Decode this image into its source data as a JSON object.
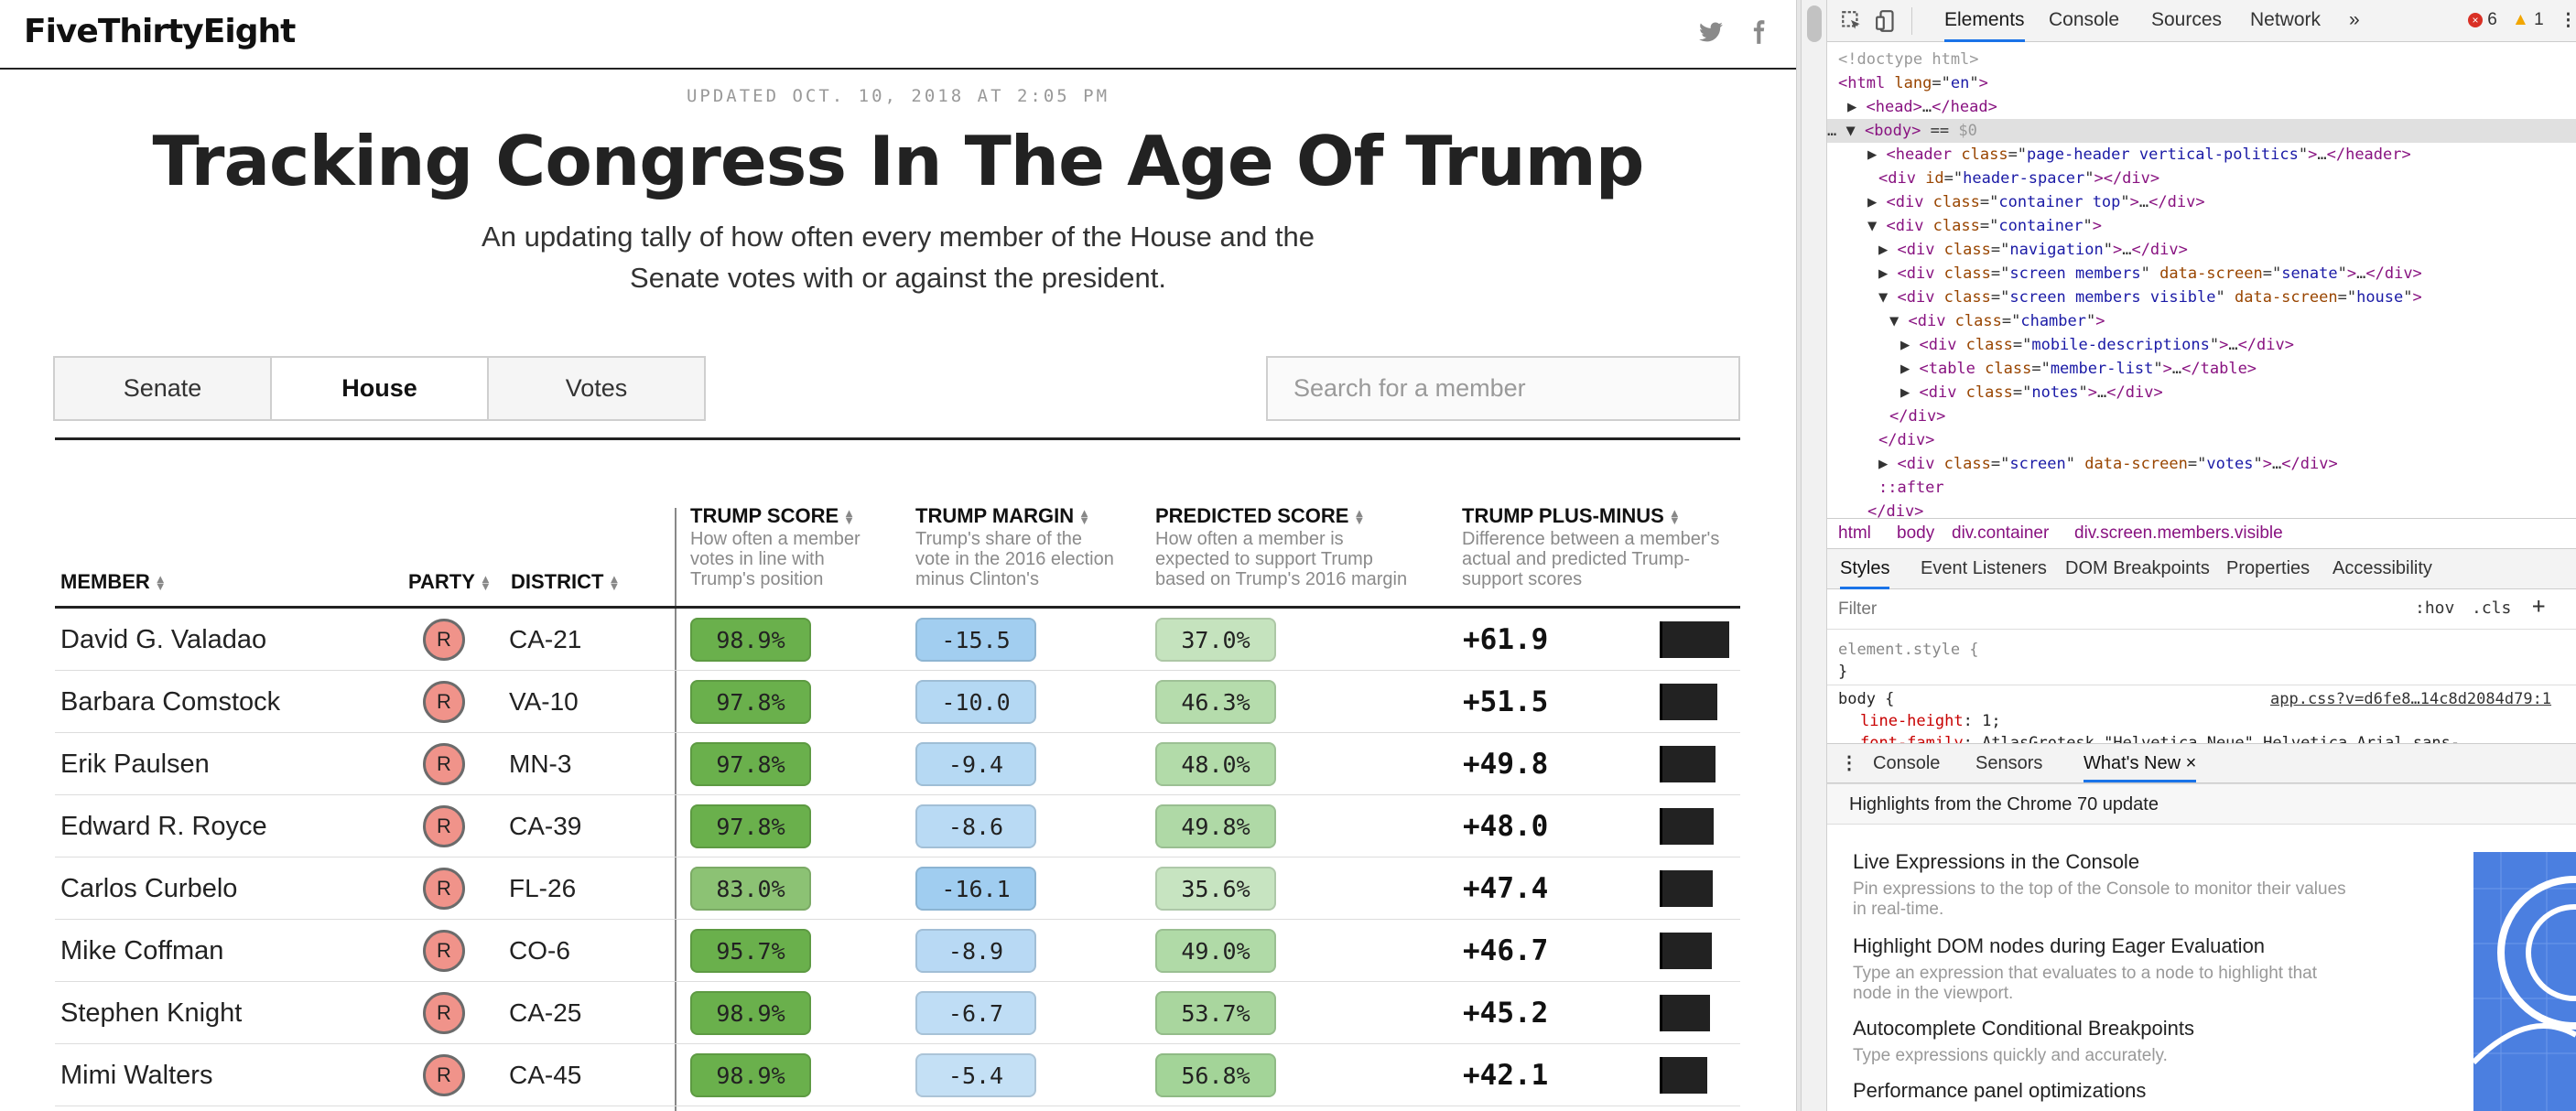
{
  "site": {
    "logo": "FiveThirtyEight",
    "twitter_icon": "twitter-icon",
    "facebook_icon": "facebook-icon"
  },
  "article": {
    "updated": "UPDATED OCT. 10, 2018 AT 2:05 PM",
    "title": "Tracking Congress In The Age Of Trump",
    "subtitle_line1": "An updating tally of how often every member of the House and the",
    "subtitle_line2": "Senate votes with or against the president."
  },
  "tabs": [
    {
      "label": "Senate",
      "active": false
    },
    {
      "label": "House",
      "active": true
    },
    {
      "label": "Votes",
      "active": false
    }
  ],
  "search": {
    "placeholder": "Search for a member"
  },
  "table": {
    "columns": {
      "member": "MEMBER",
      "party": "PARTY",
      "district": "DISTRICT",
      "trump_score": "TRUMP SCORE",
      "trump_score_desc": [
        "How often a member",
        "votes in line with",
        "Trump's position"
      ],
      "trump_margin": "TRUMP MARGIN",
      "trump_margin_desc": [
        "Trump's share of the",
        "vote in the 2016 election",
        "minus Clinton's"
      ],
      "predicted_score": "PREDICTED SCORE",
      "predicted_score_desc": [
        "How often a member is",
        "expected to support Trump",
        "based on Trump's 2016 margin"
      ],
      "plus_minus": "TRUMP PLUS-MINUS",
      "plus_minus_desc": [
        "Difference between a member's",
        "actual and predicted Trump-",
        "support scores"
      ]
    },
    "sort_icon": "sort-arrows-icon",
    "party_color": "#f0938a",
    "rows": [
      {
        "member": "David G. Valadao",
        "party": "R",
        "district": "CA-21",
        "trump_score": "98.9%",
        "trump_margin": "-15.5",
        "predicted_score": "37.0%",
        "plus_minus": "+61.9",
        "plus_minus_value": 61.9
      },
      {
        "member": "Barbara Comstock",
        "party": "R",
        "district": "VA-10",
        "trump_score": "97.8%",
        "trump_margin": "-10.0",
        "predicted_score": "46.3%",
        "plus_minus": "+51.5",
        "plus_minus_value": 51.5
      },
      {
        "member": "Erik Paulsen",
        "party": "R",
        "district": "MN-3",
        "trump_score": "97.8%",
        "trump_margin": "-9.4",
        "predicted_score": "48.0%",
        "plus_minus": "+49.8",
        "plus_minus_value": 49.8
      },
      {
        "member": "Edward R. Royce",
        "party": "R",
        "district": "CA-39",
        "trump_score": "97.8%",
        "trump_margin": "-8.6",
        "predicted_score": "49.8%",
        "plus_minus": "+48.0",
        "plus_minus_value": 48.0
      },
      {
        "member": "Carlos Curbelo",
        "party": "R",
        "district": "FL-26",
        "trump_score": "83.0%",
        "trump_margin": "-16.1",
        "predicted_score": "35.6%",
        "plus_minus": "+47.4",
        "plus_minus_value": 47.4
      },
      {
        "member": "Mike Coffman",
        "party": "R",
        "district": "CO-6",
        "trump_score": "95.7%",
        "trump_margin": "-8.9",
        "predicted_score": "49.0%",
        "plus_minus": "+46.7",
        "plus_minus_value": 46.7
      },
      {
        "member": "Stephen Knight",
        "party": "R",
        "district": "CA-25",
        "trump_score": "98.9%",
        "trump_margin": "-6.7",
        "predicted_score": "53.7%",
        "plus_minus": "+45.2",
        "plus_minus_value": 45.2
      },
      {
        "member": "Mimi Walters",
        "party": "R",
        "district": "CA-45",
        "trump_score": "98.9%",
        "trump_margin": "-5.4",
        "predicted_score": "56.8%",
        "plus_minus": "+42.1",
        "plus_minus_value": 42.1
      }
    ]
  },
  "devtools": {
    "toolbar": {
      "inspect_icon": "inspect-icon",
      "device_icon": "device-toggle-icon",
      "tabs": [
        "Elements",
        "Console",
        "Sources",
        "Network"
      ],
      "more": "»",
      "errors": "6",
      "warnings": "1",
      "menu_icon": "kebab-menu-icon"
    },
    "dom_lines": [
      [
        [
          "cm",
          "<!doctype html>"
        ]
      ],
      [
        [
          "tg",
          "<html "
        ],
        [
          "at",
          "lang"
        ],
        [
          "tx",
          "=\""
        ],
        [
          "av",
          "en"
        ],
        [
          "tx",
          "\""
        ],
        [
          "tg",
          ">"
        ]
      ],
      [
        [
          "tx",
          "▶ "
        ],
        [
          "tg",
          "<head>"
        ],
        [
          "tx",
          "…"
        ],
        [
          "tg",
          "</head>"
        ]
      ],
      [
        [
          "tx",
          "… ▼ "
        ],
        [
          "tg",
          "<body>"
        ],
        [
          "tx",
          " == "
        ],
        [
          "cm",
          "$0"
        ]
      ],
      [
        [
          "tx",
          "▶ "
        ],
        [
          "tg",
          "<header "
        ],
        [
          "at",
          "class"
        ],
        [
          "tx",
          "=\""
        ],
        [
          "av",
          "page-header vertical-politics"
        ],
        [
          "tx",
          "\""
        ],
        [
          "tg",
          ">"
        ],
        [
          "tx",
          "…"
        ],
        [
          "tg",
          "</header>"
        ]
      ],
      [
        [
          "tg",
          "<div "
        ],
        [
          "at",
          "id"
        ],
        [
          "tx",
          "=\""
        ],
        [
          "av",
          "header-spacer"
        ],
        [
          "tx",
          "\""
        ],
        [
          "tg",
          "></div>"
        ]
      ],
      [
        [
          "tx",
          "▶ "
        ],
        [
          "tg",
          "<div "
        ],
        [
          "at",
          "class"
        ],
        [
          "tx",
          "=\""
        ],
        [
          "av",
          "container top"
        ],
        [
          "tx",
          "\""
        ],
        [
          "tg",
          ">"
        ],
        [
          "tx",
          "…"
        ],
        [
          "tg",
          "</div>"
        ]
      ],
      [
        [
          "tx",
          "▼ "
        ],
        [
          "tg",
          "<div "
        ],
        [
          "at",
          "class"
        ],
        [
          "tx",
          "=\""
        ],
        [
          "av",
          "container"
        ],
        [
          "tx",
          "\""
        ],
        [
          "tg",
          ">"
        ]
      ],
      [
        [
          "tx",
          "▶ "
        ],
        [
          "tg",
          "<div "
        ],
        [
          "at",
          "class"
        ],
        [
          "tx",
          "=\""
        ],
        [
          "av",
          "navigation"
        ],
        [
          "tx",
          "\""
        ],
        [
          "tg",
          ">"
        ],
        [
          "tx",
          "…"
        ],
        [
          "tg",
          "</div>"
        ]
      ],
      [
        [
          "tx",
          "▶ "
        ],
        [
          "tg",
          "<div "
        ],
        [
          "at",
          "class"
        ],
        [
          "tx",
          "=\""
        ],
        [
          "av",
          "screen members"
        ],
        [
          "tx",
          "\" "
        ],
        [
          "at",
          "data-screen"
        ],
        [
          "tx",
          "=\""
        ],
        [
          "av",
          "senate"
        ],
        [
          "tx",
          "\""
        ],
        [
          "tg",
          ">"
        ],
        [
          "tx",
          "…"
        ],
        [
          "tg",
          "</div>"
        ]
      ],
      [
        [
          "tx",
          "▼ "
        ],
        [
          "tg",
          "<div "
        ],
        [
          "at",
          "class"
        ],
        [
          "tx",
          "=\""
        ],
        [
          "av",
          "screen members visible"
        ],
        [
          "tx",
          "\" "
        ],
        [
          "at",
          "data-screen"
        ],
        [
          "tx",
          "=\""
        ],
        [
          "av",
          "house"
        ],
        [
          "tx",
          "\""
        ],
        [
          "tg",
          ">"
        ]
      ],
      [
        [
          "tx",
          "▼ "
        ],
        [
          "tg",
          "<div "
        ],
        [
          "at",
          "class"
        ],
        [
          "tx",
          "=\""
        ],
        [
          "av",
          "chamber"
        ],
        [
          "tx",
          "\""
        ],
        [
          "tg",
          ">"
        ]
      ],
      [
        [
          "tx",
          "▶ "
        ],
        [
          "tg",
          "<div "
        ],
        [
          "at",
          "class"
        ],
        [
          "tx",
          "=\""
        ],
        [
          "av",
          "mobile-descriptions"
        ],
        [
          "tx",
          "\""
        ],
        [
          "tg",
          ">"
        ],
        [
          "tx",
          "…"
        ],
        [
          "tg",
          "</div>"
        ]
      ],
      [
        [
          "tx",
          "▶ "
        ],
        [
          "tg",
          "<table "
        ],
        [
          "at",
          "class"
        ],
        [
          "tx",
          "=\""
        ],
        [
          "av",
          "member-list"
        ],
        [
          "tx",
          "\""
        ],
        [
          "tg",
          ">"
        ],
        [
          "tx",
          "…"
        ],
        [
          "tg",
          "</table>"
        ]
      ],
      [
        [
          "tx",
          "▶ "
        ],
        [
          "tg",
          "<div "
        ],
        [
          "at",
          "class"
        ],
        [
          "tx",
          "=\""
        ],
        [
          "av",
          "notes"
        ],
        [
          "tx",
          "\""
        ],
        [
          "tg",
          ">"
        ],
        [
          "tx",
          "…"
        ],
        [
          "tg",
          "</div>"
        ]
      ],
      [
        [
          "tg",
          "</div>"
        ]
      ],
      [
        [
          "tg",
          "</div>"
        ]
      ],
      [
        [
          "tx",
          "▶ "
        ],
        [
          "tg",
          "<div "
        ],
        [
          "at",
          "class"
        ],
        [
          "tx",
          "=\""
        ],
        [
          "av",
          "screen"
        ],
        [
          "tx",
          "\" "
        ],
        [
          "at",
          "data-screen"
        ],
        [
          "tx",
          "=\""
        ],
        [
          "av",
          "votes"
        ],
        [
          "tx",
          "\""
        ],
        [
          "tg",
          ">"
        ],
        [
          "tx",
          "…"
        ],
        [
          "tg",
          "</div>"
        ]
      ],
      [
        [
          "tg",
          "::after"
        ]
      ],
      [
        [
          "tg",
          "</div>"
        ]
      ]
    ],
    "breadcrumbs": [
      "html",
      "body",
      "div.container",
      "div.screen.members.visible"
    ],
    "styles_tabs": [
      "Styles",
      "Event Listeners",
      "DOM Breakpoints",
      "Properties",
      "Accessibility"
    ],
    "filter_placeholder": "Filter",
    "hov": ":hov",
    "cls": ".cls",
    "plus": "+",
    "rules": {
      "element_style": "element.style {",
      "close": "}",
      "body_selector": "body {",
      "body_source": "app.css?v=d6fe8…14c8d2084d79:1",
      "line_height_prop": "line-height",
      "line_height_val": "1;",
      "font_family_prop": "font-family",
      "font_family_val": "AtlasGrotesk,\"Helvetica Neue\",Helvetica,Arial,sans-"
    },
    "drawer_tabs": [
      "Console",
      "Sensors",
      "What's New"
    ],
    "drawer_close": "×",
    "whats_new": {
      "header": "Highlights from the Chrome 70 update",
      "items": [
        {
          "title": "Live Expressions in the Console",
          "desc1": "Pin expressions to the top of the Console to monitor their values",
          "desc2": "in real-time."
        },
        {
          "title": "Highlight DOM nodes during Eager Evaluation",
          "desc1": "Type an expression that evaluates to a node to highlight that",
          "desc2": "node in the viewport."
        },
        {
          "title": "Autocomplete Conditional Breakpoints",
          "desc1": "Type expressions quickly and accurately.",
          "desc2": ""
        },
        {
          "title": "Performance panel optimizations",
          "desc1": "",
          "desc2": ""
        }
      ]
    }
  }
}
